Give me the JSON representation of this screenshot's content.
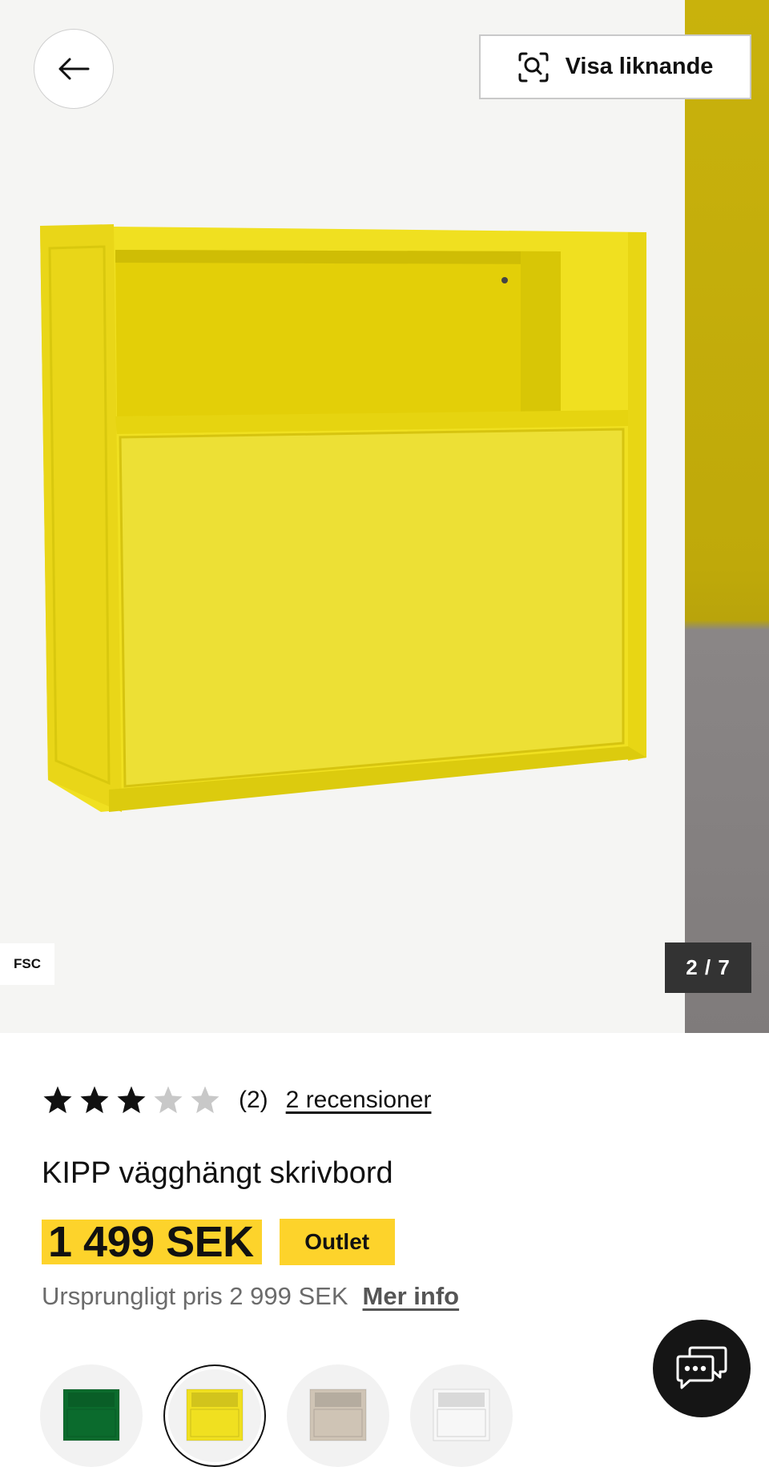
{
  "gallery": {
    "similar_label": "Visa liknande",
    "fsc_label": "FSC",
    "counter": "2 / 7",
    "product_color": "#f0e020"
  },
  "icons": {
    "back": "arrow-left-icon",
    "similar": "visual-search-icon",
    "chat": "chat-icon",
    "star": "star-icon"
  },
  "rating": {
    "value": 3,
    "max": 5,
    "count_text": "(2)",
    "reviews_link": "2 recensioner",
    "filled_color": "#111111",
    "empty_color": "#c8c8c8"
  },
  "product": {
    "title": "KIPP vägghängt skrivbord",
    "price": "1 499 SEK",
    "badge": "Outlet",
    "original_price": "Ursprungligt pris 2 999 SEK",
    "more_info": "Mer info"
  },
  "swatches": [
    {
      "color": "#0b6b2d",
      "selected": false
    },
    {
      "color": "#f0e020",
      "selected": true
    },
    {
      "color": "#cfc4b5",
      "selected": false
    },
    {
      "color": "#f7f7f7",
      "selected": false
    }
  ],
  "colors": {
    "accent_yellow": "#fdd32b",
    "counter_bg": "#333333",
    "chat_bg": "#151515"
  }
}
